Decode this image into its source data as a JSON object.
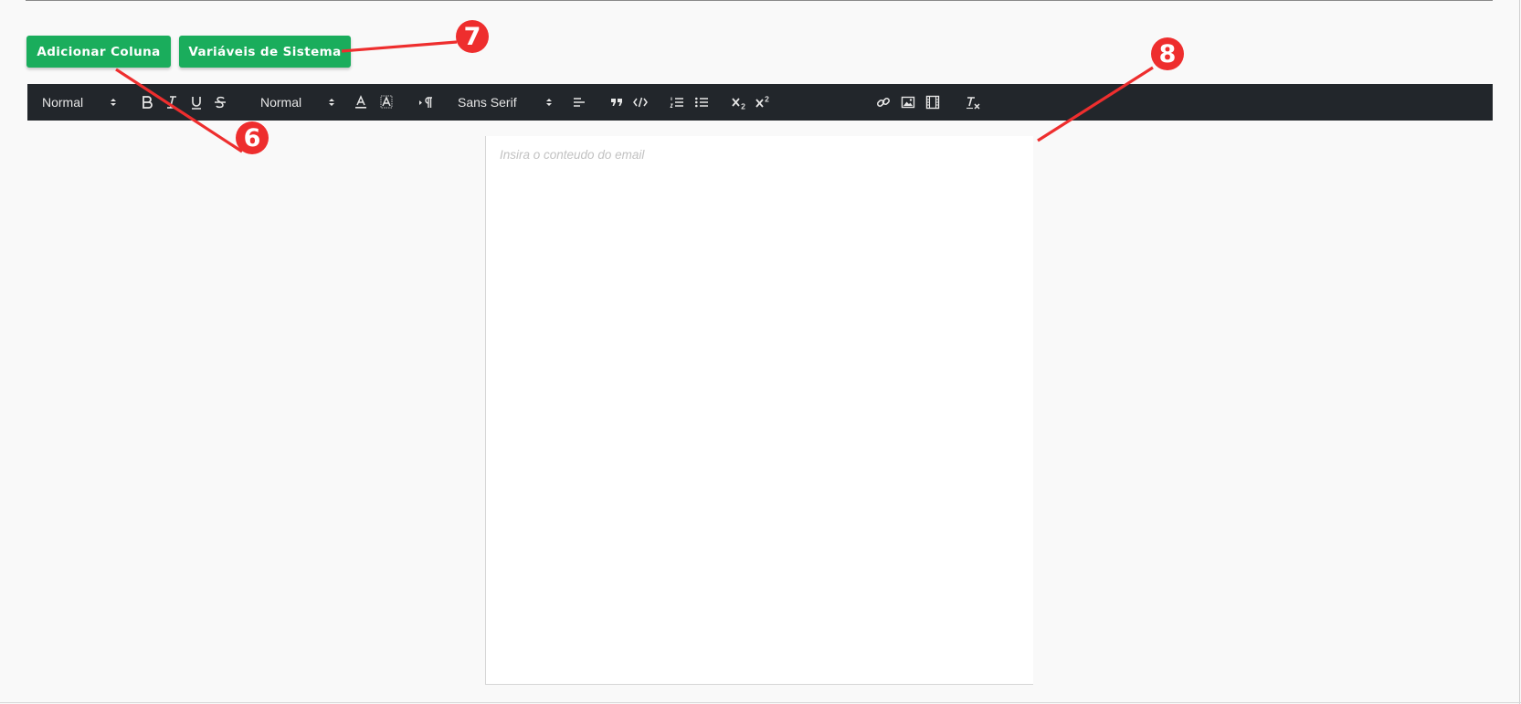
{
  "buttons": {
    "add_column": "Adicionar Coluna",
    "system_variables": "Variáveis de Sistema"
  },
  "toolbar": {
    "header_picker": "Normal",
    "size_picker": "Normal",
    "font_picker": "Sans Serif",
    "icons": [
      "bold-icon",
      "italic-icon",
      "underline-icon",
      "strike-icon",
      "font-color-icon",
      "background-color-icon",
      "text-direction-icon",
      "align-icon",
      "blockquote-icon",
      "code-block-icon",
      "ordered-list-icon",
      "bullet-list-icon",
      "subscript-icon",
      "superscript-icon",
      "link-icon",
      "image-icon",
      "video-icon",
      "clean-format-icon"
    ]
  },
  "editor": {
    "placeholder": "Insira o conteudo do email"
  },
  "annotations": {
    "markers": [
      "6",
      "7",
      "8"
    ],
    "color": "#ee2e2e"
  },
  "colors": {
    "button_green": "#1aad5c",
    "toolbar_bg": "#22262b",
    "page_bg": "#f9f9f9"
  }
}
